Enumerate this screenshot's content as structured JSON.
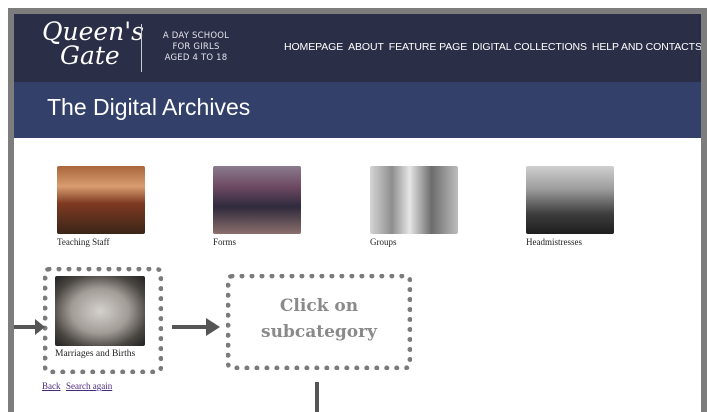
{
  "header": {
    "logo_line1": "Queen's",
    "logo_line2": "Gate",
    "tagline": [
      "A DAY SCHOOL",
      "FOR GIRLS",
      "AGED 4 TO 18"
    ],
    "nav": [
      "HOMEPAGE",
      "ABOUT",
      "FEATURE PAGE",
      "DIGITAL COLLECTIONS",
      "HELP AND CONTACTS"
    ]
  },
  "page_title": "The Digital Archives",
  "categories": [
    {
      "label": "Teaching Staff"
    },
    {
      "label": "Forms"
    },
    {
      "label": "Groups"
    },
    {
      "label": "Headmistresses"
    },
    {
      "label": "Marriages and Births"
    }
  ],
  "links": {
    "back": "Back",
    "search_again": "Search again"
  },
  "callout": {
    "line1": "Click on",
    "line2": "subcategory"
  },
  "colors": {
    "header_bg": "#2b2e47",
    "title_bg": "#32406a",
    "frame": "#7d7d7d",
    "callout": "#8a8a8a"
  }
}
